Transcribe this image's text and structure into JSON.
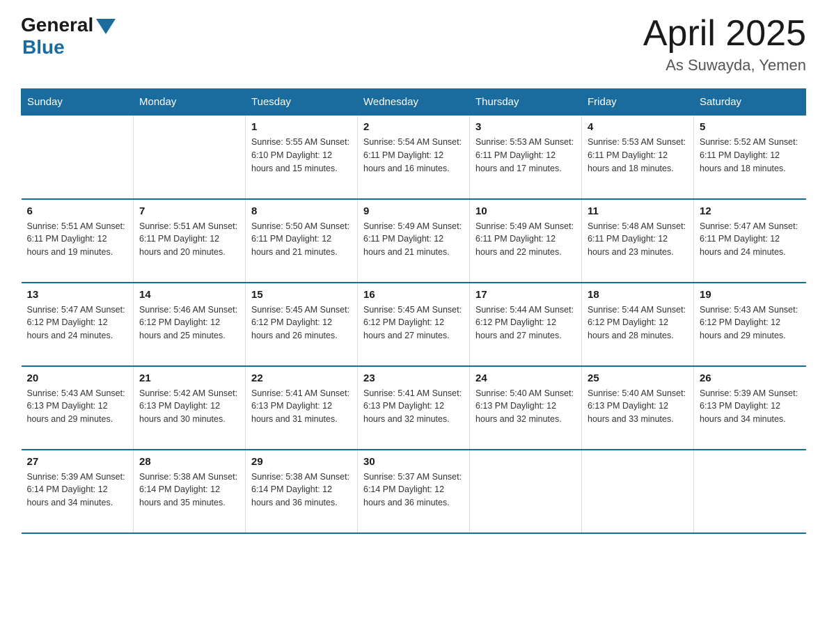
{
  "header": {
    "logo_general": "General",
    "logo_blue": "Blue",
    "month_title": "April 2025",
    "location": "As Suwayda, Yemen"
  },
  "days_of_week": [
    "Sunday",
    "Monday",
    "Tuesday",
    "Wednesday",
    "Thursday",
    "Friday",
    "Saturday"
  ],
  "weeks": [
    [
      {
        "day": "",
        "info": ""
      },
      {
        "day": "",
        "info": ""
      },
      {
        "day": "1",
        "info": "Sunrise: 5:55 AM\nSunset: 6:10 PM\nDaylight: 12 hours\nand 15 minutes."
      },
      {
        "day": "2",
        "info": "Sunrise: 5:54 AM\nSunset: 6:11 PM\nDaylight: 12 hours\nand 16 minutes."
      },
      {
        "day": "3",
        "info": "Sunrise: 5:53 AM\nSunset: 6:11 PM\nDaylight: 12 hours\nand 17 minutes."
      },
      {
        "day": "4",
        "info": "Sunrise: 5:53 AM\nSunset: 6:11 PM\nDaylight: 12 hours\nand 18 minutes."
      },
      {
        "day": "5",
        "info": "Sunrise: 5:52 AM\nSunset: 6:11 PM\nDaylight: 12 hours\nand 18 minutes."
      }
    ],
    [
      {
        "day": "6",
        "info": "Sunrise: 5:51 AM\nSunset: 6:11 PM\nDaylight: 12 hours\nand 19 minutes."
      },
      {
        "day": "7",
        "info": "Sunrise: 5:51 AM\nSunset: 6:11 PM\nDaylight: 12 hours\nand 20 minutes."
      },
      {
        "day": "8",
        "info": "Sunrise: 5:50 AM\nSunset: 6:11 PM\nDaylight: 12 hours\nand 21 minutes."
      },
      {
        "day": "9",
        "info": "Sunrise: 5:49 AM\nSunset: 6:11 PM\nDaylight: 12 hours\nand 21 minutes."
      },
      {
        "day": "10",
        "info": "Sunrise: 5:49 AM\nSunset: 6:11 PM\nDaylight: 12 hours\nand 22 minutes."
      },
      {
        "day": "11",
        "info": "Sunrise: 5:48 AM\nSunset: 6:11 PM\nDaylight: 12 hours\nand 23 minutes."
      },
      {
        "day": "12",
        "info": "Sunrise: 5:47 AM\nSunset: 6:11 PM\nDaylight: 12 hours\nand 24 minutes."
      }
    ],
    [
      {
        "day": "13",
        "info": "Sunrise: 5:47 AM\nSunset: 6:12 PM\nDaylight: 12 hours\nand 24 minutes."
      },
      {
        "day": "14",
        "info": "Sunrise: 5:46 AM\nSunset: 6:12 PM\nDaylight: 12 hours\nand 25 minutes."
      },
      {
        "day": "15",
        "info": "Sunrise: 5:45 AM\nSunset: 6:12 PM\nDaylight: 12 hours\nand 26 minutes."
      },
      {
        "day": "16",
        "info": "Sunrise: 5:45 AM\nSunset: 6:12 PM\nDaylight: 12 hours\nand 27 minutes."
      },
      {
        "day": "17",
        "info": "Sunrise: 5:44 AM\nSunset: 6:12 PM\nDaylight: 12 hours\nand 27 minutes."
      },
      {
        "day": "18",
        "info": "Sunrise: 5:44 AM\nSunset: 6:12 PM\nDaylight: 12 hours\nand 28 minutes."
      },
      {
        "day": "19",
        "info": "Sunrise: 5:43 AM\nSunset: 6:12 PM\nDaylight: 12 hours\nand 29 minutes."
      }
    ],
    [
      {
        "day": "20",
        "info": "Sunrise: 5:43 AM\nSunset: 6:13 PM\nDaylight: 12 hours\nand 29 minutes."
      },
      {
        "day": "21",
        "info": "Sunrise: 5:42 AM\nSunset: 6:13 PM\nDaylight: 12 hours\nand 30 minutes."
      },
      {
        "day": "22",
        "info": "Sunrise: 5:41 AM\nSunset: 6:13 PM\nDaylight: 12 hours\nand 31 minutes."
      },
      {
        "day": "23",
        "info": "Sunrise: 5:41 AM\nSunset: 6:13 PM\nDaylight: 12 hours\nand 32 minutes."
      },
      {
        "day": "24",
        "info": "Sunrise: 5:40 AM\nSunset: 6:13 PM\nDaylight: 12 hours\nand 32 minutes."
      },
      {
        "day": "25",
        "info": "Sunrise: 5:40 AM\nSunset: 6:13 PM\nDaylight: 12 hours\nand 33 minutes."
      },
      {
        "day": "26",
        "info": "Sunrise: 5:39 AM\nSunset: 6:13 PM\nDaylight: 12 hours\nand 34 minutes."
      }
    ],
    [
      {
        "day": "27",
        "info": "Sunrise: 5:39 AM\nSunset: 6:14 PM\nDaylight: 12 hours\nand 34 minutes."
      },
      {
        "day": "28",
        "info": "Sunrise: 5:38 AM\nSunset: 6:14 PM\nDaylight: 12 hours\nand 35 minutes."
      },
      {
        "day": "29",
        "info": "Sunrise: 5:38 AM\nSunset: 6:14 PM\nDaylight: 12 hours\nand 36 minutes."
      },
      {
        "day": "30",
        "info": "Sunrise: 5:37 AM\nSunset: 6:14 PM\nDaylight: 12 hours\nand 36 minutes."
      },
      {
        "day": "",
        "info": ""
      },
      {
        "day": "",
        "info": ""
      },
      {
        "day": "",
        "info": ""
      }
    ]
  ]
}
